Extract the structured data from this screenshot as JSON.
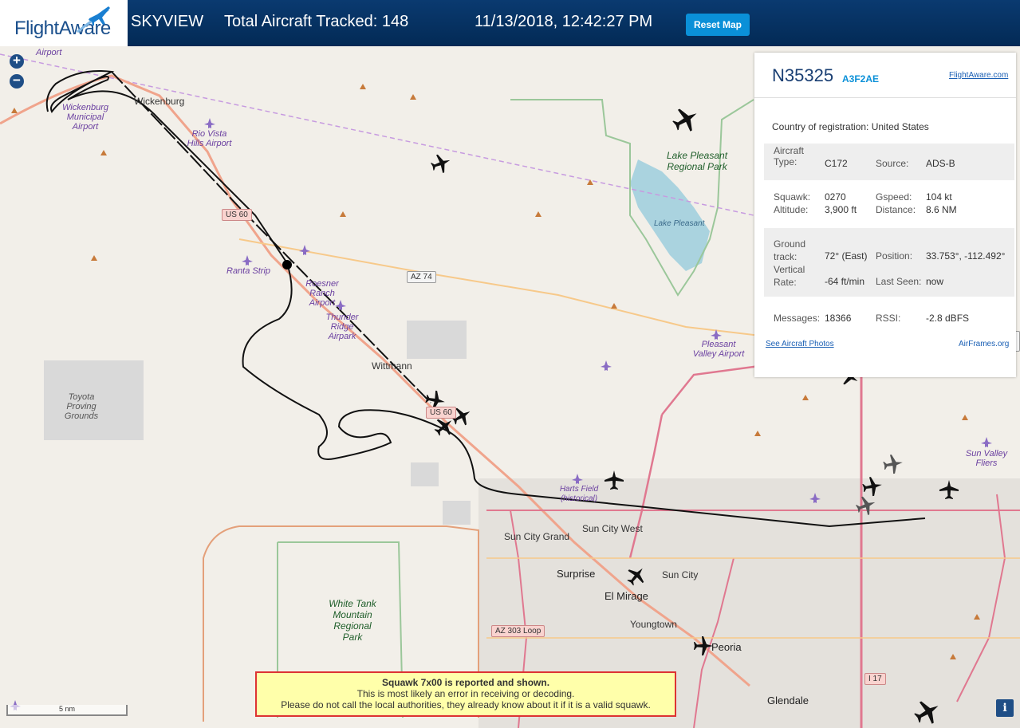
{
  "header": {
    "logo_text": "FlightAware",
    "skyview": "SKYVIEW",
    "total_tracked": "Total Aircraft Tracked: 148",
    "datetime": "11/13/2018, 12:42:27 PM",
    "reset_label": "Reset Map"
  },
  "map": {
    "zoom_in": "+",
    "zoom_out": "−",
    "scale_label": "5 nm",
    "info_label": "i",
    "labels": {
      "airport_top": "Airport",
      "wickenburg_airport": "Wickenburg Municipal Airport",
      "wickenburg": "Wickenburg",
      "rio_vista": "Rio Vista Hills Airport",
      "ranta": "Ranta Strip",
      "roesner": "Roesner Ranch Airport",
      "thunder": "Thunder Ridge Airpark",
      "wittmann": "Wittmann",
      "toyota": "Toyota Proving Grounds",
      "lake_pleasant_park": "Lake Pleasant Regional Park",
      "lake_pleasant": "Lake Pleasant",
      "pleasant_valley": "Pleasant Valley Airport",
      "harts_field": "Harts Field (historical)",
      "sun_city_grand": "Sun City Grand",
      "sun_city_west": "Sun City West",
      "surprise": "Surprise",
      "sun_city": "Sun City",
      "el_mirage": "El Mirage",
      "youngtown": "Youngtown",
      "peoria": "Peoria",
      "glendale": "Glendale",
      "white_tank": "White Tank Mountain Regional Park",
      "sun_valley": "Sun Valley Fliers",
      "us60_a": "US 60",
      "us60_b": "US 60",
      "az74": "AZ 74",
      "az74_right": "AZ 74",
      "az303": "AZ 303 Loop",
      "i17": "I 17"
    }
  },
  "panel": {
    "registration": "N35325",
    "hex": "A3F2AE",
    "flightaware_link": "FlightAware.com",
    "country_label": "Country of registration:",
    "country": "United States",
    "aircraft_type_label": "Aircraft Type:",
    "aircraft_type": "C172",
    "source_label": "Source:",
    "source": "ADS-B",
    "squawk_label": "Squawk:",
    "squawk": "0270",
    "altitude_label": "Altitude:",
    "altitude": "3,900 ft",
    "gspeed_label": "Gspeed:",
    "gspeed": "104 kt",
    "distance_label": "Distance:",
    "distance": "8.6 NM",
    "ground_track_label": "Ground track:",
    "ground_track": "72° (East)",
    "position_label": "Position:",
    "position": "33.753°, -112.492°",
    "vertical_rate_label": "Vertical Rate:",
    "vertical_rate": "-64 ft/min",
    "last_seen_label": "Last Seen:",
    "last_seen": "now",
    "messages_label": "Messages:",
    "messages": "18366",
    "rssi_label": "RSSI:",
    "rssi": "-2.8 dBFS",
    "photos_link": "See Aircraft Photos",
    "airframes_link": "AirFrames.org"
  },
  "squawk_banner": {
    "line1": "Squawk 7x00 is reported and shown.",
    "line2": "This is most likely an error in receiving or decoding.",
    "line3": "Please do not call the local authorities, they already know about it if it is a valid squawk."
  }
}
